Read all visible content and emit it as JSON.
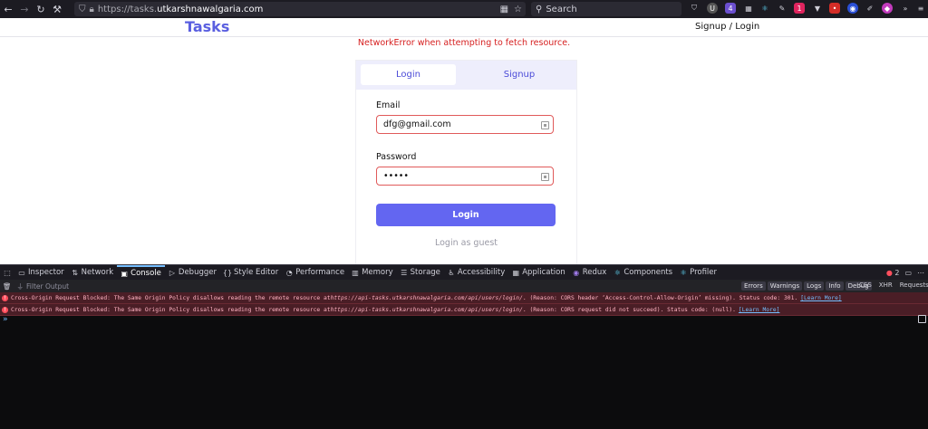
{
  "browser": {
    "url_scheme": "https://tasks.",
    "url_host": "utkarshnawalgaria.com",
    "search_placeholder": "Search",
    "badges": {
      "ext1": "4",
      "ext2": "1"
    }
  },
  "header": {
    "brand": "Tasks",
    "nav_link": "Signup / Login"
  },
  "error_message": "NetworkError when attempting to fetch resource.",
  "form": {
    "tabs": [
      {
        "label": "Login",
        "active": true
      },
      {
        "label": "Signup",
        "active": false
      }
    ],
    "email_label": "Email",
    "email_value": "dfg@gmail.com",
    "password_label": "Password",
    "password_value": "•••••",
    "submit_label": "Login",
    "guest_label": "Login as guest"
  },
  "devtools": {
    "tabs": [
      "Inspector",
      "Network",
      "Console",
      "Debugger",
      "Style Editor",
      "Performance",
      "Memory",
      "Storage",
      "Accessibility",
      "Application",
      "Redux",
      "Components",
      "Profiler"
    ],
    "active_tab": "Console",
    "error_count": "2",
    "filter_placeholder": "Filter Output",
    "filter_buttons": [
      "Errors",
      "Warnings",
      "Logs",
      "Info",
      "Debug"
    ],
    "extra_filters": [
      "CSS",
      "XHR",
      "Requests"
    ],
    "messages": [
      {
        "prefix": "Cross-Origin Request Blocked: The Same Origin Policy disallows reading the remote resource at ",
        "url": "https://api-tasks.utkarshnawalgaria.com/api/users/login/",
        "suffix": ". (Reason: CORS header ‘Access-Control-Allow-Origin’ missing). Status code: 301.",
        "link": "[Learn More]"
      },
      {
        "prefix": "Cross-Origin Request Blocked: The Same Origin Policy disallows reading the remote resource at ",
        "url": "https://api-tasks.utkarshnawalgaria.com/api/users/login/",
        "suffix": ". (Reason: CORS request did not succeed). Status code: (null).",
        "link": "[Learn More]"
      }
    ],
    "prompt_symbol": "»"
  },
  "colors": {
    "brand": "#5a5fe0",
    "button": "#6366f1",
    "error": "#d62020",
    "devtools_bg": "#0c0c0d"
  }
}
